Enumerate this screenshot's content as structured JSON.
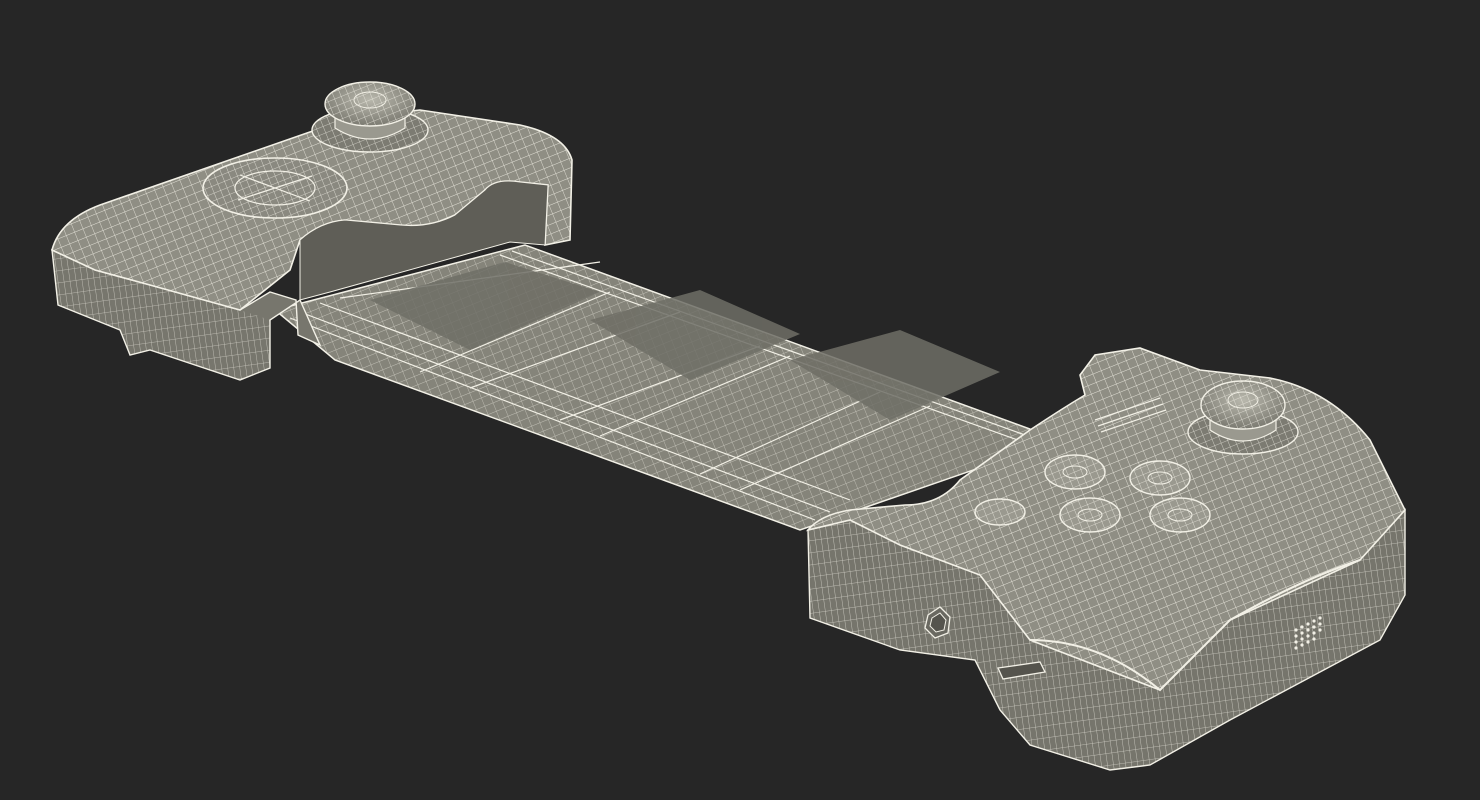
{
  "scene": {
    "subject": "wireframe-mobile-game-controller",
    "render_style": "wireframe-over-shaded",
    "colors": {
      "background": "#262626",
      "body_fill": "#8f8e84",
      "body_shade": "#6d6c64",
      "bridge_fill": "#85847a",
      "wire": "#f2f0e6"
    }
  }
}
